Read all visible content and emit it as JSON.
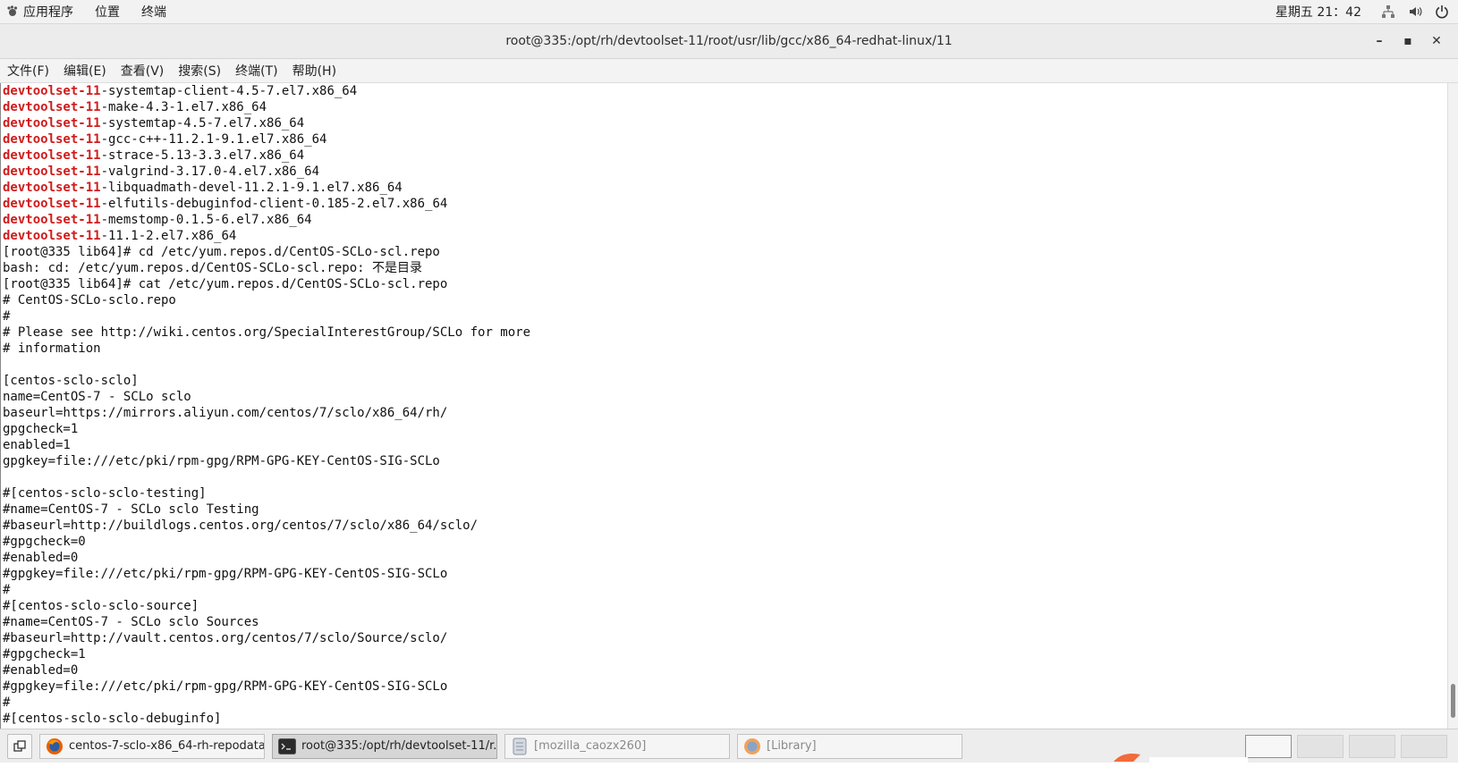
{
  "topbar": {
    "applications": "应用程序",
    "places": "位置",
    "terminal": "终端",
    "clock": "星期五 21：42"
  },
  "window": {
    "title": "root@335:/opt/rh/devtoolset-11/root/usr/lib/gcc/x86_64-redhat-linux/11",
    "minimize": "–",
    "maximize": "▪",
    "close": "✕"
  },
  "menubar": {
    "items": [
      "文件(F)",
      "编辑(E)",
      "查看(V)",
      "搜索(S)",
      "终端(T)",
      "帮助(H)"
    ]
  },
  "terminal": {
    "lines": [
      {
        "prefix": "devtoolset-11",
        "text": "-systemtap-client-4.5-7.el7.x86_64"
      },
      {
        "prefix": "devtoolset-11",
        "text": "-make-4.3-1.el7.x86_64"
      },
      {
        "prefix": "devtoolset-11",
        "text": "-systemtap-4.5-7.el7.x86_64"
      },
      {
        "prefix": "devtoolset-11",
        "text": "-gcc-c++-11.2.1-9.1.el7.x86_64"
      },
      {
        "prefix": "devtoolset-11",
        "text": "-strace-5.13-3.3.el7.x86_64"
      },
      {
        "prefix": "devtoolset-11",
        "text": "-valgrind-3.17.0-4.el7.x86_64"
      },
      {
        "prefix": "devtoolset-11",
        "text": "-libquadmath-devel-11.2.1-9.1.el7.x86_64"
      },
      {
        "prefix": "devtoolset-11",
        "text": "-elfutils-debuginfod-client-0.185-2.el7.x86_64"
      },
      {
        "prefix": "devtoolset-11",
        "text": "-memstomp-0.1.5-6.el7.x86_64"
      },
      {
        "prefix": "devtoolset-11",
        "text": "-11.1-2.el7.x86_64"
      },
      {
        "prefix": "",
        "text": "[root@335 lib64]# cd /etc/yum.repos.d/CentOS-SCLo-scl.repo"
      },
      {
        "prefix": "",
        "text": "bash: cd: /etc/yum.repos.d/CentOS-SCLo-scl.repo: 不是目录"
      },
      {
        "prefix": "",
        "text": "[root@335 lib64]# cat /etc/yum.repos.d/CentOS-SCLo-scl.repo"
      },
      {
        "prefix": "",
        "text": "# CentOS-SCLo-sclo.repo"
      },
      {
        "prefix": "",
        "text": "#"
      },
      {
        "prefix": "",
        "text": "# Please see http://wiki.centos.org/SpecialInterestGroup/SCLo for more"
      },
      {
        "prefix": "",
        "text": "# information"
      },
      {
        "prefix": "",
        "text": ""
      },
      {
        "prefix": "",
        "text": "[centos-sclo-sclo]"
      },
      {
        "prefix": "",
        "text": "name=CentOS-7 - SCLo sclo"
      },
      {
        "prefix": "",
        "text": "baseurl=https://mirrors.aliyun.com/centos/7/sclo/x86_64/rh/"
      },
      {
        "prefix": "",
        "text": "gpgcheck=1"
      },
      {
        "prefix": "",
        "text": "enabled=1"
      },
      {
        "prefix": "",
        "text": "gpgkey=file:///etc/pki/rpm-gpg/RPM-GPG-KEY-CentOS-SIG-SCLo"
      },
      {
        "prefix": "",
        "text": ""
      },
      {
        "prefix": "",
        "text": "#[centos-sclo-sclo-testing]"
      },
      {
        "prefix": "",
        "text": "#name=CentOS-7 - SCLo sclo Testing"
      },
      {
        "prefix": "",
        "text": "#baseurl=http://buildlogs.centos.org/centos/7/sclo/x86_64/sclo/"
      },
      {
        "prefix": "",
        "text": "#gpgcheck=0"
      },
      {
        "prefix": "",
        "text": "#enabled=0"
      },
      {
        "prefix": "",
        "text": "#gpgkey=file:///etc/pki/rpm-gpg/RPM-GPG-KEY-CentOS-SIG-SCLo"
      },
      {
        "prefix": "",
        "text": "#"
      },
      {
        "prefix": "",
        "text": "#[centos-sclo-sclo-source]"
      },
      {
        "prefix": "",
        "text": "#name=CentOS-7 - SCLo sclo Sources"
      },
      {
        "prefix": "",
        "text": "#baseurl=http://vault.centos.org/centos/7/sclo/Source/sclo/"
      },
      {
        "prefix": "",
        "text": "#gpgcheck=1"
      },
      {
        "prefix": "",
        "text": "#enabled=0"
      },
      {
        "prefix": "",
        "text": "#gpgkey=file:///etc/pki/rpm-gpg/RPM-GPG-KEY-CentOS-SIG-SCLo"
      },
      {
        "prefix": "",
        "text": "#"
      },
      {
        "prefix": "",
        "text": "#[centos-sclo-sclo-debuginfo]"
      }
    ]
  },
  "taskbar": {
    "tasks": [
      {
        "label": "centos-7-sclo-x86_64-rh-repodata...",
        "icon": "firefox-icon"
      },
      {
        "label": "root@335:/opt/rh/devtoolset-11/r...",
        "icon": "terminal-icon"
      },
      {
        "label": "[mozilla_caozx260]",
        "icon": "file-manager-icon"
      },
      {
        "label": "[Library]",
        "icon": "firefox-icon"
      }
    ]
  },
  "colors": {
    "prefix_red": "#d11b1b",
    "terminal_bg": "#ffffff",
    "panel_bg": "#ededed"
  }
}
